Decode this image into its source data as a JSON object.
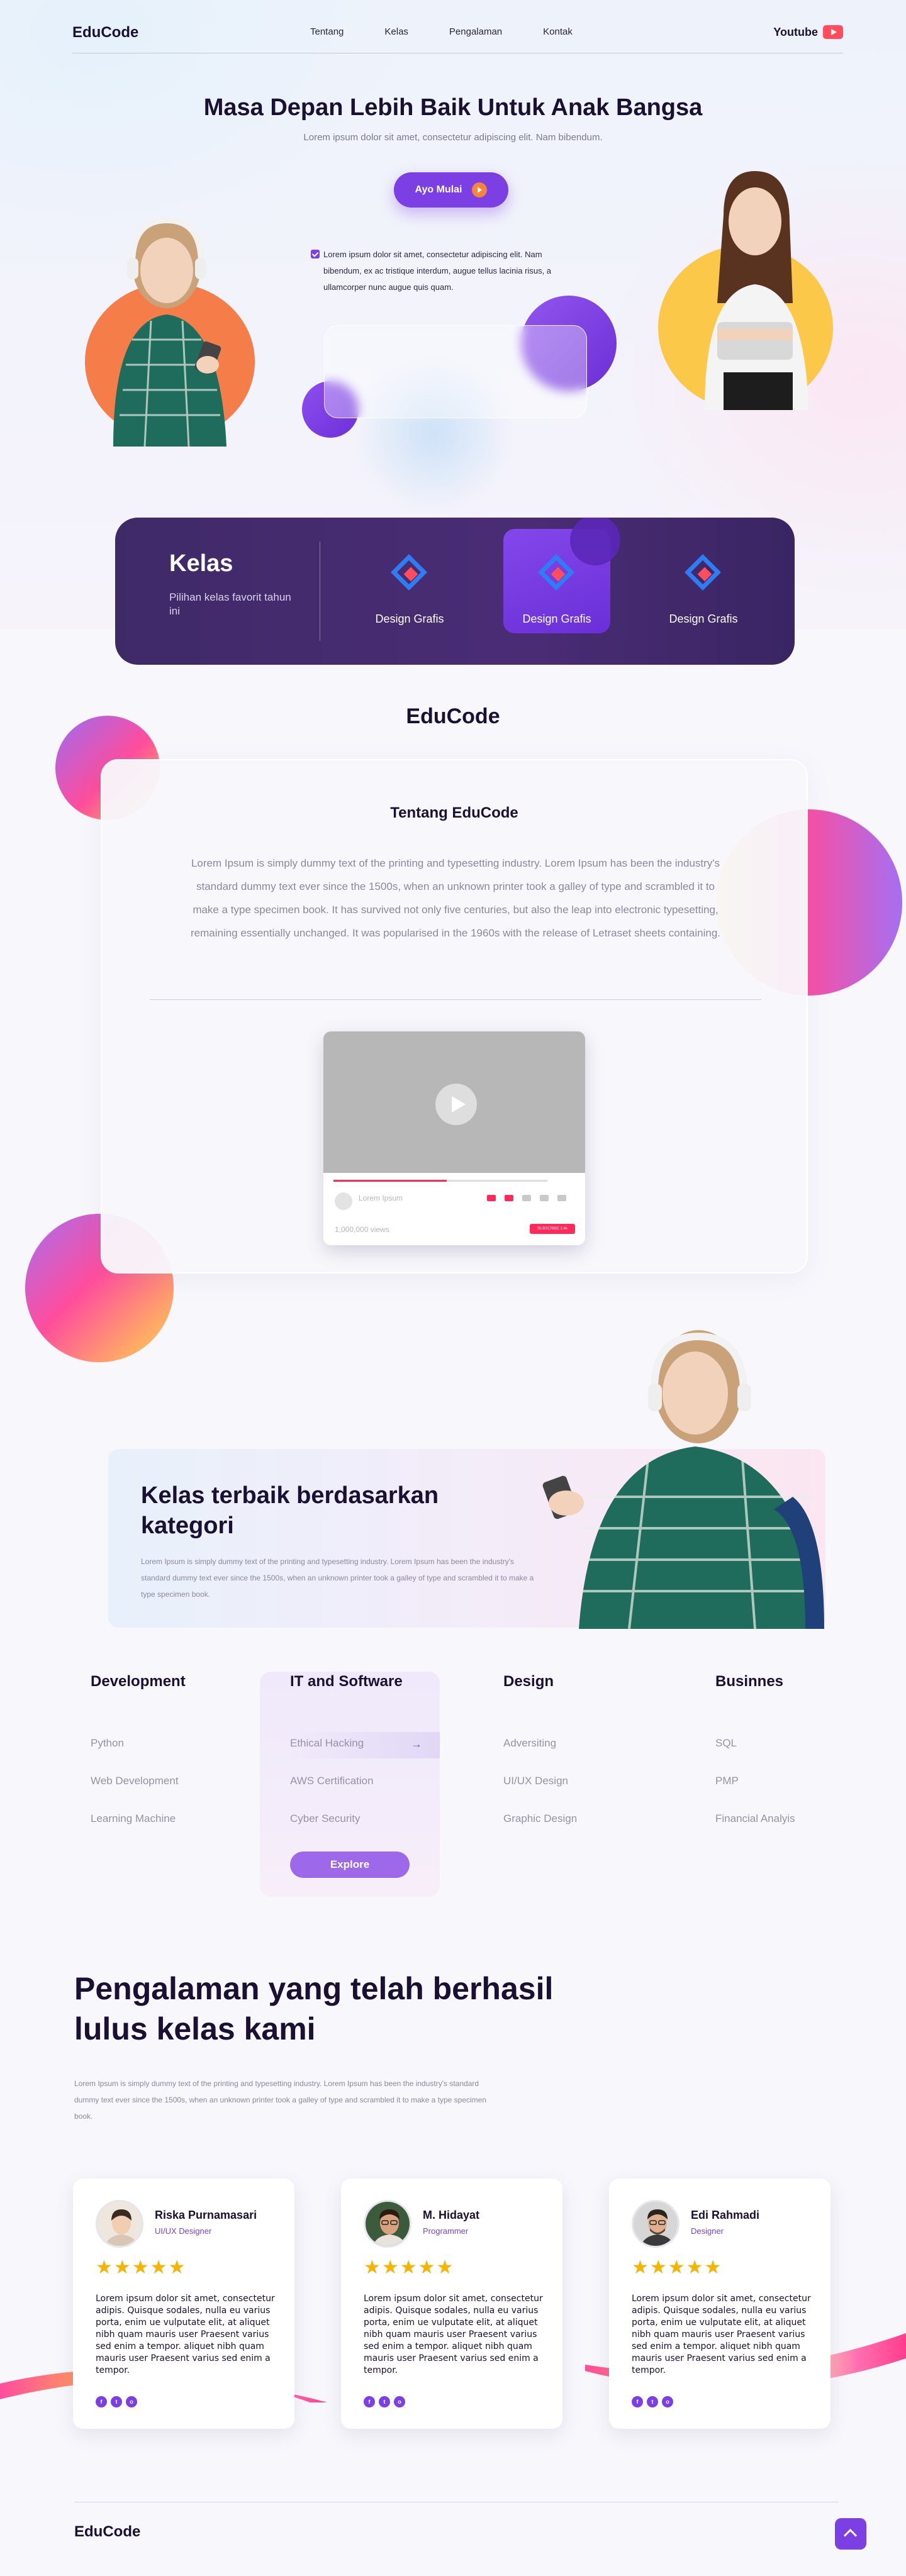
{
  "nav": {
    "brand": "EduCode",
    "links": [
      "Tentang",
      "Kelas",
      "Pengalaman",
      "Kontak"
    ],
    "youtube": "Youtube",
    "youtube_icon": "youtube-icon"
  },
  "hero": {
    "title": "Masa Depan Lebih Baik Untuk Anak Bangsa",
    "subtitle": "Lorem ipsum dolor sit amet, consectetur adipiscing elit. Nam bibendum.",
    "cta": "Ayo Mulai",
    "paragraph": "Lorem ipsum dolor sit amet, consectetur adipiscing elit. Nam bibendum, ex ac tristique interdum, augue tellus lacinia risus, a ullamcorper nunc augue quis quam."
  },
  "kelas": {
    "title": "Kelas",
    "subtitle": "Pilihan kelas favorit tahun ini",
    "items": [
      {
        "label": "Design Grafis",
        "icon": "diamond-logo-icon"
      },
      {
        "label": "Design Grafis",
        "icon": "diamond-logo-icon"
      },
      {
        "label": "Design Grafis",
        "icon": "diamond-logo-icon"
      }
    ]
  },
  "about": {
    "brand": "EduCode",
    "title": "Tentang EduCode",
    "text": "Lorem Ipsum is simply dummy text of the printing and typesetting industry. Lorem Ipsum has been the industry's standard dummy text ever since the 1500s, when an unknown printer took a galley of type and scrambled it to make a type specimen book. It has survived not only five centuries, but also the leap into electronic typesetting, remaining essentially unchanged. It was popularised in the 1960s with the release of Letraset sheets containing.",
    "video": {
      "channel": "Lorem Ipsum",
      "views": "1,000,000 views",
      "subscribe": "SUBSCRIBE 2.4k",
      "progress": 0.53
    }
  },
  "banner": {
    "title": "Kelas terbaik berdasarkan kategori",
    "text": "Lorem Ipsum is simply dummy text of the printing and typesetting industry. Lorem Ipsum has been the industry's standard dummy text ever since the 1500s, when an unknown printer took a galley of type and scrambled it to make a type specimen book."
  },
  "categories": [
    {
      "title": "Development",
      "items": [
        "Python",
        "Web Development",
        "Learning Machine"
      ]
    },
    {
      "title": "IT and Software",
      "items": [
        "Ethical Hacking",
        "AWS Certification",
        "Cyber Security"
      ],
      "button": "Explore"
    },
    {
      "title": "Design",
      "items": [
        "Adversiting",
        "UI/UX Design",
        "Graphic Design"
      ]
    },
    {
      "title": "Businnes",
      "items": [
        "SQL",
        "PMP",
        "Financial Analyis"
      ]
    }
  ],
  "experience": {
    "title": "Pengalaman yang telah berhasil lulus kelas kami",
    "text": "Lorem Ipsum is simply dummy text of the printing and typesetting industry. Lorem Ipsum has been the industry's standard dummy text ever since the 1500s, when an unknown printer took a galley of type and scrambled it to make a type specimen book."
  },
  "testimonials": [
    {
      "name": "Riska Purnamasari",
      "role": "UI/UX Designer",
      "stars": "★★★★★",
      "text": "Lorem ipsum dolor sit amet, consectetur adipis. Quisque sodales, nulla eu varius porta, enim ue vulputate elit, at aliquet nibh quam mauris user Praesent varius sed enim a tempor. aliquet nibh quam mauris user Praesent varius sed enim a tempor."
    },
    {
      "name": "M. Hidayat",
      "role": "Programmer",
      "stars": "★★★★★",
      "text": "Lorem ipsum dolor sit amet, consectetur adipis. Quisque sodales, nulla eu varius porta, enim ue vulputate elit, at aliquet nibh quam mauris user Praesent varius sed enim a tempor. aliquet nibh quam mauris user Praesent varius sed enim a tempor."
    },
    {
      "name": "Edi Rahmadi",
      "role": "Designer",
      "stars": "★★★★★",
      "text": "Lorem ipsum dolor sit amet, consectetur adipis. Quisque sodales, nulla eu varius porta, enim ue vulputate elit, at aliquet nibh quam mauris user Praesent varius sed enim a tempor. aliquet nibh quam mauris user Praesent varius sed enim a tempor."
    }
  ],
  "social_icons": [
    "facebook-icon",
    "twitter-icon",
    "instagram-icon"
  ],
  "footer": {
    "brand": "EduCode",
    "to_top_icon": "chevron-up-icon"
  },
  "colors": {
    "accent": "#7b3fe4",
    "orange": "#f7843c",
    "yellow": "#fbc84a",
    "pink": "#ff4d9d",
    "dark_card": "#45296f",
    "youtube": "#ff4d5e",
    "stars": "#f5b400"
  }
}
